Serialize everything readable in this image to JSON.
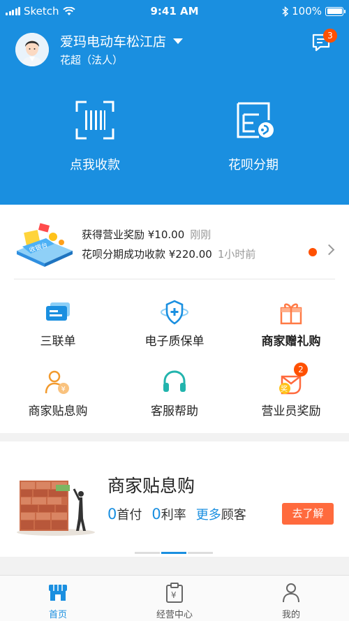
{
  "status_bar": {
    "carrier": "Sketch",
    "time": "9:41 AM",
    "battery": "100%"
  },
  "header": {
    "shop_name": "爱玛电动车松江店",
    "owner": "花超（法人）",
    "message_count": "3",
    "actions": [
      {
        "label": "点我收款",
        "icon": "scan-qr-icon"
      },
      {
        "label": "花呗分期",
        "icon": "installment-icon"
      }
    ]
  },
  "notifications": {
    "items": [
      {
        "text": "获得营业奖励 ¥10.00",
        "time": "刚刚"
      },
      {
        "text": "花呗分期成功收款 ¥220.00",
        "time": "1小时前"
      }
    ]
  },
  "grid": [
    {
      "label": "三联单",
      "icon": "receipt-icon"
    },
    {
      "label": "电子质保单",
      "icon": "warranty-shield-icon"
    },
    {
      "label": "商家赠礼购",
      "icon": "gift-icon"
    },
    {
      "label": "商家贴息购",
      "icon": "user-yuan-icon"
    },
    {
      "label": "客服帮助",
      "icon": "headset-icon"
    },
    {
      "label": "营业员奖励",
      "icon": "reward-icon",
      "badge": "2"
    }
  ],
  "promo": {
    "title": "商家贴息购",
    "zero1": "0",
    "word1": "首付",
    "zero2": "0",
    "word2": "利率",
    "more": "更多",
    "word3": "顾客",
    "button": "去了解"
  },
  "tabbar": [
    {
      "label": "首页",
      "icon": "store-icon",
      "active": true
    },
    {
      "label": "经营中心",
      "icon": "clipboard-yuan-icon",
      "active": false
    },
    {
      "label": "我的",
      "icon": "person-icon",
      "active": false
    }
  ],
  "colors": {
    "primary": "#1a8fe0",
    "accent": "#ff5000",
    "button": "#ff6a3d"
  }
}
